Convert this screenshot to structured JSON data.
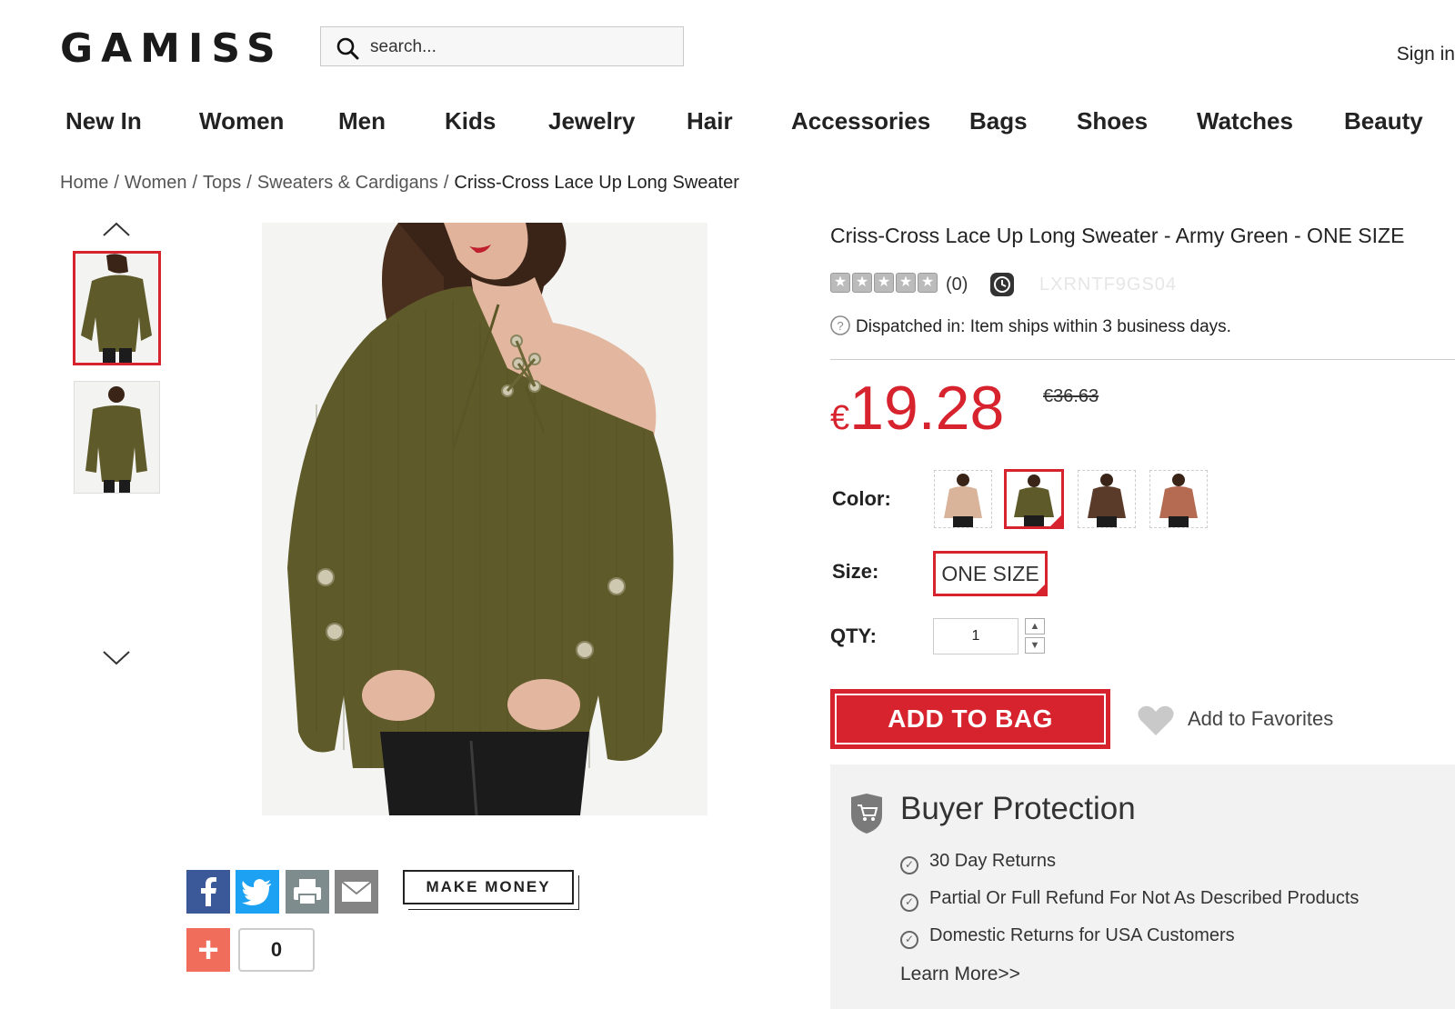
{
  "header": {
    "logo": "GAMISS",
    "search_placeholder": "search...",
    "sign_in": "Sign in"
  },
  "nav": {
    "items": [
      "New In",
      "Women",
      "Men",
      "Kids",
      "Jewelry",
      "Hair",
      "Accessories",
      "Bags",
      "Shoes",
      "Watches",
      "Beauty"
    ]
  },
  "breadcrumb": {
    "items": [
      "Home",
      "Women",
      "Tops",
      "Sweaters & Cardigans",
      "Criss-Cross Lace Up Long Sweater"
    ],
    "separator": "/"
  },
  "product": {
    "title": "Criss-Cross Lace Up Long Sweater - Army Green - ONE SIZE",
    "rating_count": "(0)",
    "rating_stars": 0,
    "sku": "LXRNTF9GS04",
    "dispatch_label": "Dispatched in:",
    "dispatch_text": "Item ships within 3 business days.",
    "currency": "€",
    "price": "19.28",
    "old_price": "€36.63",
    "color_label": "Color:",
    "size_label": "Size:",
    "size_value": "ONE SIZE",
    "qty_label": "QTY:",
    "qty_value": "1",
    "add_to_bag": "ADD TO BAG",
    "add_to_favorites": "Add to Favorites",
    "colors": [
      {
        "name": "apricot",
        "hex": "#d9b39a"
      },
      {
        "name": "army-green",
        "hex": "#5e5a2a"
      },
      {
        "name": "coffee",
        "hex": "#5a3a28"
      },
      {
        "name": "brick-red",
        "hex": "#b56a52"
      }
    ],
    "selected_color": "army-green"
  },
  "buyer_protection": {
    "title": "Buyer Protection",
    "items": [
      "30 Day Returns",
      "Partial Or Full Refund For Not As Described Products",
      "Domestic Returns for USA Customers"
    ],
    "learn_more": "Learn More>>"
  },
  "share": {
    "make_money": "MAKE MONEY",
    "plus_count": "0"
  },
  "colors": {
    "accent": "#d7232e",
    "sweater": "#5e5a2a"
  }
}
